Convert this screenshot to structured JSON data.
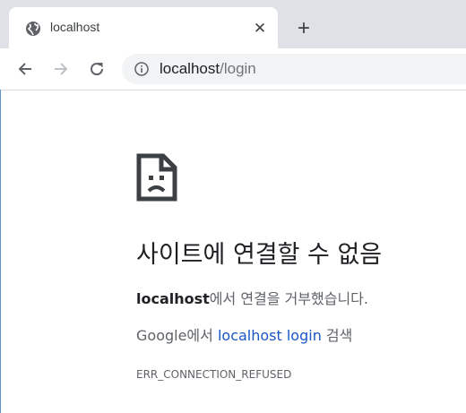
{
  "tab": {
    "title": "localhost",
    "close_symbol": "✕",
    "favicon": "globe-icon"
  },
  "new_tab_symbol": "+",
  "toolbar": {
    "url_host": "localhost",
    "url_path": "/login",
    "icons": [
      "back-icon",
      "forward-icon",
      "reload-icon",
      "info-icon"
    ]
  },
  "error": {
    "icon": "sad-document-icon",
    "title": "사이트에 연결할 수 없음",
    "host": "localhost",
    "message_suffix": "에서 연결을 거부했습니다.",
    "suggest_prefix": "Google에서 ",
    "suggest_link": "localhost login",
    "suggest_suffix": " 검색",
    "code": "ERR_CONNECTION_REFUSED"
  },
  "colors": {
    "tabstrip": "#dee1e6",
    "omnibox": "#f1f3f4",
    "link": "#1a56c4",
    "secondary_text": "#5f6368"
  }
}
